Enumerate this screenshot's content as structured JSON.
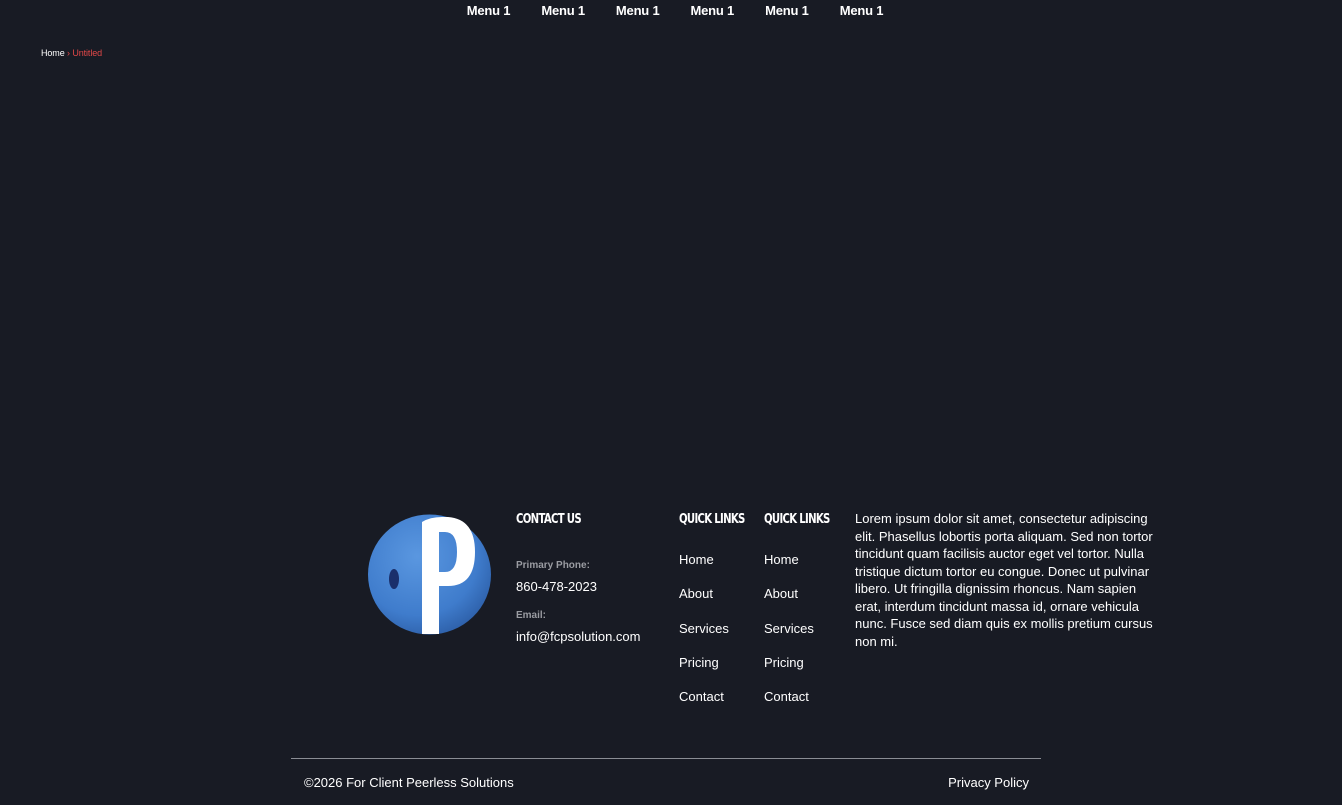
{
  "nav": {
    "items": [
      "Menu 1",
      "Menu 1",
      "Menu 1",
      "Menu 1",
      "Menu 1",
      "Menu 1"
    ]
  },
  "breadcrumb": {
    "home": "Home",
    "separator": "›",
    "current": "Untitled"
  },
  "footer": {
    "logo_icon": "fcp-logo-icon",
    "contact": {
      "heading": "CONTACT US",
      "phone_label": "Primary Phone:",
      "phone": "860-478-2023",
      "email_label": "Email:",
      "email": "info@fcpsolution.com"
    },
    "quick_links_1": {
      "heading": "QUICK LINKS",
      "items": [
        "Home",
        "About",
        "Services",
        "Pricing",
        "Contact"
      ]
    },
    "quick_links_2": {
      "heading": "QUICK LINKS",
      "items": [
        "Home",
        "About",
        "Services",
        "Pricing",
        "Contact"
      ]
    },
    "about_text": "Lorem ipsum dolor sit amet, consectetur adipiscing elit. Phasellus lobortis porta aliquam. Sed non tortor tincidunt quam facilisis auctor eget vel tortor. Nulla tristique dictum tortor eu congue. Donec ut pulvinar libero. Ut fringilla dignissim rhoncus. Nam sapien erat, interdum tincidunt massa id, ornare vehicula nunc. Fusce sed diam quis ex mollis pretium cursus non mi.",
    "copyright": "©2026 For Client Peerless Solutions",
    "privacy": "Privacy Policy"
  },
  "colors": {
    "background": "#181b24",
    "accent_red": "#e04848",
    "logo_blue": "#3f7ccc",
    "muted_label": "#9a9ca2"
  }
}
